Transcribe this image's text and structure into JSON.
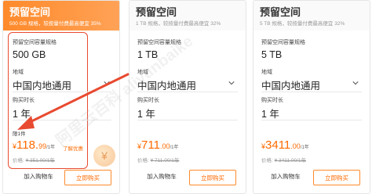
{
  "watermark": "阿里云百科 aliyunbaike",
  "cards": [
    {
      "title": "预留空间",
      "subtitle": "500 GB 规格，较按量付费最高便宜 35%",
      "spec_label": "预留空间容量规格",
      "spec_value": "500 GB",
      "region_label": "地域",
      "region_value": "中国内地通用",
      "duration_label": "购买时长",
      "duration_value": "1 年",
      "limit_tag": "限1件",
      "price_currency": "¥",
      "price_amount": "118.",
      "price_decimal": "99",
      "price_unit": "/1年",
      "promo_text": "了解优惠",
      "orig_label": "价格:",
      "orig_value": "¥ 351.00/1年",
      "cart_label": "加入购物车",
      "buy_label": "立即购买",
      "selected": true
    },
    {
      "title": "预留空间",
      "subtitle": "1 TB 规格，较按量付费最高便宜 32%",
      "spec_label": "预留空间容量规格",
      "spec_value": "1 TB",
      "region_label": "地域",
      "region_value": "中国内地通用",
      "duration_label": "购买时长",
      "duration_value": "1 年",
      "price_currency": "¥",
      "price_amount": "711",
      "price_decimal": ".00",
      "price_unit": "/1年",
      "orig_label": "价格:",
      "orig_value": "¥ 711.00/1年",
      "cart_label": "加入购物车",
      "buy_label": "立即购买",
      "selected": false
    },
    {
      "title": "预留空间",
      "subtitle": "5 TB 规格，较按量付费最高便宜 32%",
      "spec_label": "预留空间容量规格",
      "spec_value": "5 TB",
      "region_label": "地域",
      "region_value": "中国内地通用",
      "duration_label": "购买时长",
      "duration_value": "1 年",
      "price_currency": "¥",
      "price_amount": "3411",
      "price_decimal": ".00",
      "price_unit": "/1年",
      "orig_label": "价格:",
      "orig_value": "¥ 3411.00/1年",
      "cart_label": "加入购物车",
      "buy_label": "立即购买",
      "selected": false
    }
  ],
  "colors": {
    "accent": "#ff6a00",
    "highlight_border": "#e84a30",
    "arrow": "#e84a30",
    "header_orange": "#ff8a2b"
  }
}
